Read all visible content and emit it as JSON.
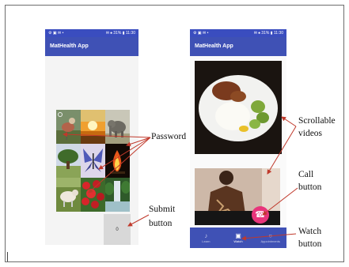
{
  "phone1": {
    "status_left": "⚙ ▣ ✉ •",
    "status_right": "✉ ♠ 31% ▮ 11:30",
    "app_title": "MatHealth App",
    "submit_label": "0"
  },
  "phone2": {
    "status_left": "⚙ ▣ ✉ •",
    "status_right": "✉ ♠ 31% ▮ 11:30",
    "app_title": "MatHealth App",
    "call_icon": "☎",
    "nav": [
      {
        "label": "Learn",
        "icon": "♪"
      },
      {
        "label": "Watch",
        "icon": "▣"
      },
      {
        "label": "Appointments",
        "icon": "○"
      }
    ]
  },
  "annotations": {
    "password": "Password",
    "submit_1": "Submit",
    "submit_2": "button",
    "scrollable_1": "Scrollable",
    "scrollable_2": "videos",
    "call_1": "Call",
    "call_2": "button",
    "watch_1": "Watch",
    "watch_2": "button"
  },
  "password_images": [
    "bird-icon",
    "sunset-icon",
    "elephant-icon",
    "tree-icon",
    "butterfly-icon",
    "fire-icon",
    "goat-icon",
    "flowers-icon",
    "waterfall-icon"
  ],
  "colors": {
    "appbar": "#3f51b5",
    "call": "#e8357b",
    "annotation_line": "#c0392b"
  }
}
